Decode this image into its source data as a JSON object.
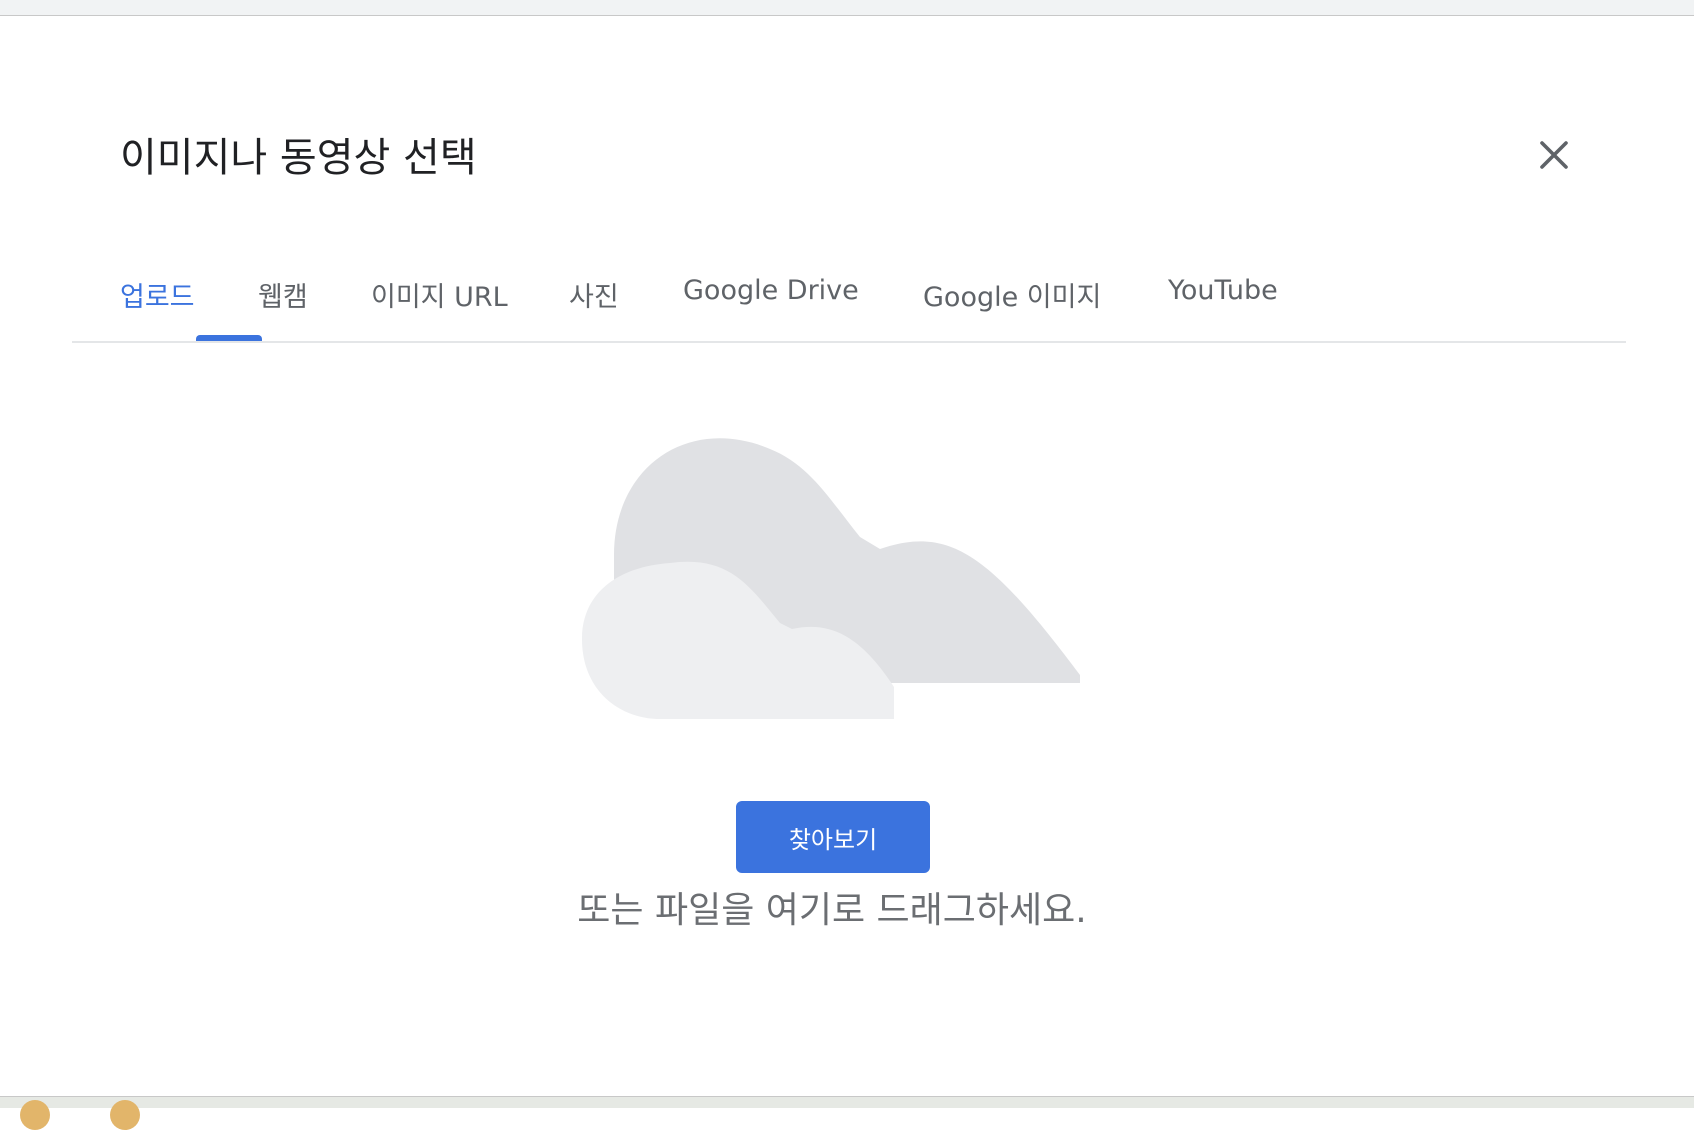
{
  "dialog": {
    "title": "이미지나 동영상 선택",
    "close_icon": "close-icon"
  },
  "tabs": [
    {
      "label": "업로드",
      "active": true
    },
    {
      "label": "웹캠",
      "active": false
    },
    {
      "label": "이미지 URL",
      "active": false
    },
    {
      "label": "사진",
      "active": false
    },
    {
      "label": "Google Drive",
      "active": false
    },
    {
      "label": "Google 이미지",
      "active": false
    },
    {
      "label": "YouTube",
      "active": false
    }
  ],
  "upload": {
    "illustration_icon": "cloud-illustration-icon",
    "browse_label": "찾아보기",
    "drag_hint": "또는 파일을 여기로 드래그하세요."
  },
  "colors": {
    "accent": "#3b73de",
    "title_text": "#202124",
    "tab_text": "#5f6368",
    "cloud_back": "#e0e1e4",
    "cloud_front": "#eeeff1"
  }
}
